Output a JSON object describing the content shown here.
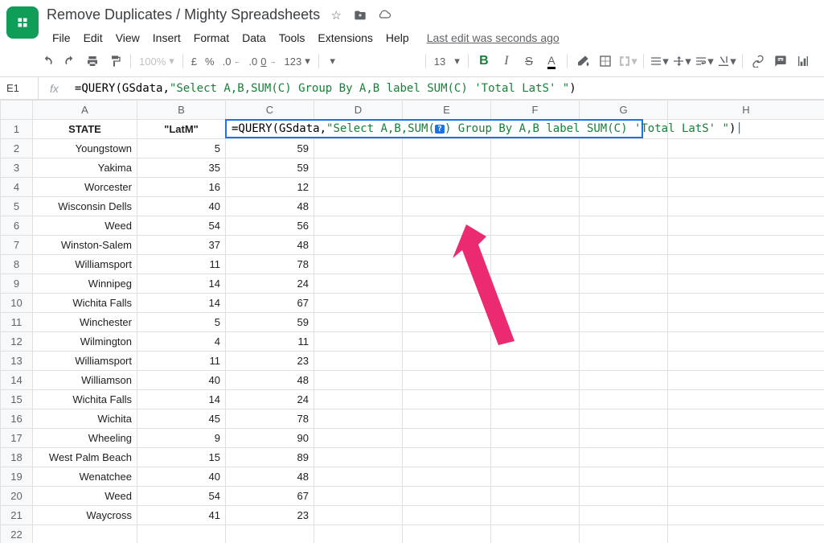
{
  "doc": {
    "title": "Remove Duplicates / Mighty Spreadsheets",
    "last_edit": "Last edit was seconds ago"
  },
  "menu": {
    "file": "File",
    "edit": "Edit",
    "view": "View",
    "insert": "Insert",
    "format": "Format",
    "data": "Data",
    "tools": "Tools",
    "extensions": "Extensions",
    "help": "Help"
  },
  "toolbar": {
    "zoom": "100%",
    "currency": "£",
    "percent": "%",
    "dec_dec": ".0",
    "dec_inc": ".00",
    "more_fmt": "123",
    "font_size": "13"
  },
  "namebox": "E1",
  "formula": {
    "prefix": "=QUERY(",
    "arg1": "GSdata",
    "comma": ",",
    "str_open": "\"",
    "str_body": "Select A,B,SUM(C) Group By A,B label SUM(C) 'Total LatS' ",
    "str_close": "\"",
    "suffix": ")"
  },
  "cell_edit": {
    "prefix": "=QUERY(",
    "arg1": "GSdata",
    "comma": ",",
    "q": "\"",
    "sel": "Select A,B,SUM(",
    "help": "?",
    "sel2": ") Group By A,B label SUM(C) 'Total LatS' ",
    "q2": "\"",
    "close": ")"
  },
  "columns": [
    "A",
    "B",
    "C",
    "D",
    "E",
    "F",
    "G",
    "H"
  ],
  "headers": {
    "A": "STATE",
    "B": "\"LatM\"",
    "C": "",
    "D": "",
    "E": "",
    "F": "",
    "G": "",
    "H": ""
  },
  "rows": [
    {
      "n": 2,
      "A": "Youngstown",
      "B": 5,
      "C": 59
    },
    {
      "n": 3,
      "A": "Yakima",
      "B": 35,
      "C": 59
    },
    {
      "n": 4,
      "A": "Worcester",
      "B": 16,
      "C": 12
    },
    {
      "n": 5,
      "A": "Wisconsin Dells",
      "B": 40,
      "C": 48
    },
    {
      "n": 6,
      "A": "Weed",
      "B": 54,
      "C": 56
    },
    {
      "n": 7,
      "A": "Winston-Salem",
      "B": 37,
      "C": 48
    },
    {
      "n": 8,
      "A": "Williamsport",
      "B": 11,
      "C": 78
    },
    {
      "n": 9,
      "A": "Winnipeg",
      "B": 14,
      "C": 24
    },
    {
      "n": 10,
      "A": "Wichita Falls",
      "B": 14,
      "C": 67
    },
    {
      "n": 11,
      "A": "Winchester",
      "B": 5,
      "C": 59
    },
    {
      "n": 12,
      "A": "Wilmington",
      "B": 4,
      "C": 11
    },
    {
      "n": 13,
      "A": "Williamsport",
      "B": 11,
      "C": 23
    },
    {
      "n": 14,
      "A": "Williamson",
      "B": 40,
      "C": 48
    },
    {
      "n": 15,
      "A": "Wichita Falls",
      "B": 14,
      "C": 24
    },
    {
      "n": 16,
      "A": "Wichita",
      "B": 45,
      "C": 78
    },
    {
      "n": 17,
      "A": "Wheeling",
      "B": 9,
      "C": 90
    },
    {
      "n": 18,
      "A": "West Palm Beach",
      "B": 15,
      "C": 89
    },
    {
      "n": 19,
      "A": "Wenatchee",
      "B": 40,
      "C": 48
    },
    {
      "n": 20,
      "A": "Weed",
      "B": 54,
      "C": 67
    },
    {
      "n": 21,
      "A": "Waycross",
      "B": 41,
      "C": 23
    },
    {
      "n": 22,
      "A": "",
      "B": "",
      "C": ""
    }
  ]
}
